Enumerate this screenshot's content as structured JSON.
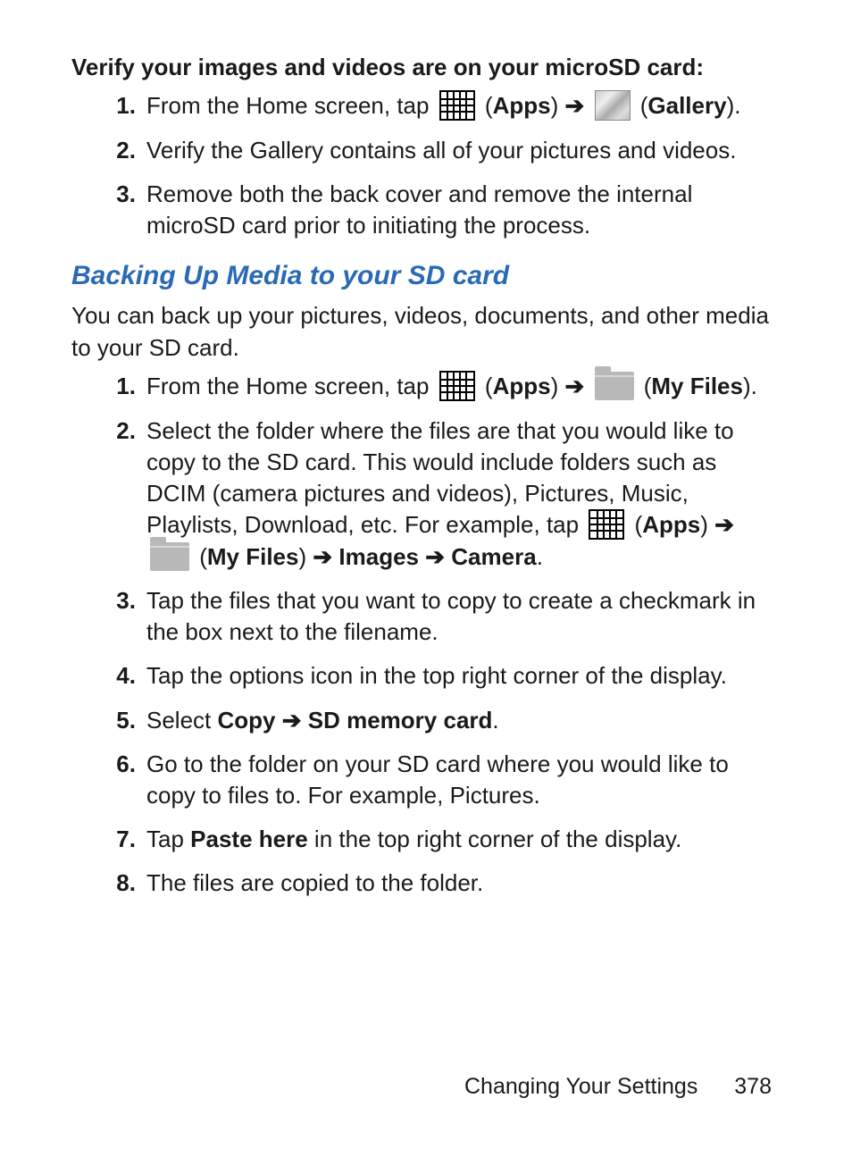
{
  "section1": {
    "heading": "Verify your images and videos are on your microSD card:",
    "steps": {
      "s1_a": "From the Home screen, tap ",
      "s1_apps": "Apps",
      "s1_gallery": "Gallery",
      "s2": "Verify the Gallery contains all of your pictures and videos.",
      "s3": "Remove both the back cover and remove the internal microSD card prior to initiating the process."
    }
  },
  "section2": {
    "heading": "Backing Up Media to your SD card",
    "intro": "You can back up your pictures, videos, documents, and other media to your SD card.",
    "steps": {
      "s1_a": "From the Home screen, tap ",
      "s1_apps": "Apps",
      "s1_myfiles": "My Files",
      "s2_a": "Select the folder where the files are that you would like to copy to the SD card. This would include folders such as DCIM (camera pictures and videos), Pictures, Music, Playlists, Download, etc. For example, tap ",
      "s2_apps": "Apps",
      "s2_myfiles": "My Files",
      "s2_images": "Images",
      "s2_camera": "Camera",
      "s3": "Tap the files that you want to copy to create a checkmark in the box next to the filename.",
      "s4": "Tap the options icon in the top right corner of the display.",
      "s5_a": "Select ",
      "s5_copy": "Copy",
      "s5_sd": "SD memory card",
      "s6": "Go to the folder on your SD card where you would like to copy to files to. For example, Pictures.",
      "s7_a": "Tap ",
      "s7_paste": "Paste here",
      "s7_b": " in the top right corner of the display.",
      "s8": "The files are copied to the folder."
    }
  },
  "footer": {
    "chapter": "Changing Your Settings",
    "page": "378"
  },
  "glyphs": {
    "arrow": "➔"
  }
}
